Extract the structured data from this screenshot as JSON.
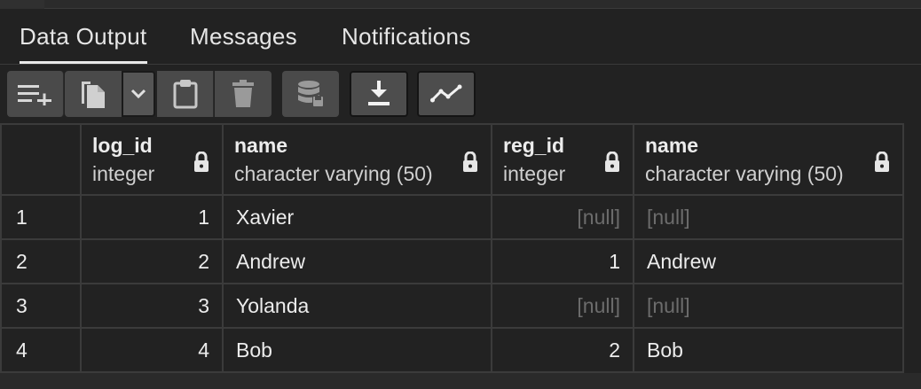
{
  "tabs": [
    {
      "label": "Data Output",
      "active": true
    },
    {
      "label": "Messages",
      "active": false
    },
    {
      "label": "Notifications",
      "active": false
    }
  ],
  "toolbar": {
    "buttons": [
      {
        "icon": "add-row-icon"
      },
      {
        "icon": "copy-icon"
      },
      {
        "icon": "chevron-down-icon"
      },
      {
        "icon": "paste-icon"
      },
      {
        "icon": "delete-icon"
      },
      {
        "icon": "save-data-icon"
      },
      {
        "icon": "download-icon"
      },
      {
        "icon": "graph-icon"
      }
    ]
  },
  "grid": {
    "columns": [
      {
        "name": "",
        "type": ""
      },
      {
        "name": "log_id",
        "type": "integer",
        "locked": true
      },
      {
        "name": "name",
        "type": "character varying (50)",
        "locked": true
      },
      {
        "name": "reg_id",
        "type": "integer",
        "locked": true
      },
      {
        "name": "name",
        "type": "character varying (50)",
        "locked": true
      }
    ],
    "rows": [
      [
        "1",
        "1",
        "Xavier",
        "[null]",
        "[null]"
      ],
      [
        "2",
        "2",
        "Andrew",
        "1",
        "Andrew"
      ],
      [
        "3",
        "3",
        "Yolanda",
        "[null]",
        "[null]"
      ],
      [
        "4",
        "4",
        "Bob",
        "2",
        "Bob"
      ]
    ]
  },
  "colors": {
    "background": "#222222",
    "button": "#4a4a4a",
    "null_text": "#6c6c6c",
    "grid_line": "#3b3b3b"
  }
}
